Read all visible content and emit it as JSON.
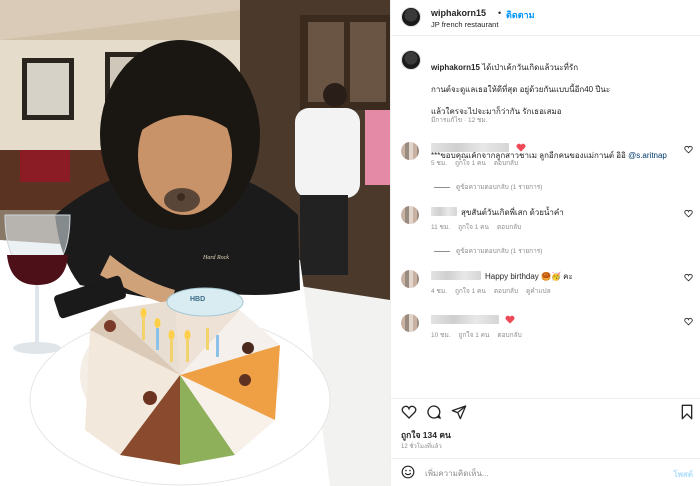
{
  "header": {
    "username": "wiphakorn15",
    "separator": "•",
    "follow_label": "ติดตาม",
    "location": "JP french restaurant"
  },
  "caption": {
    "username": "wiphakorn15",
    "text_line1": "ได้เป่าเค้กวันเกิดแล้วนะที่รัก",
    "text_line2": "กานต์จะดูแลเธอให้ดีที่สุด อยู่ด้วยกันแบบนี้อีก40 ปีนะ",
    "text_line3": "แล้วใครจะไปจะมาก็ว่ากัน รักเธอเสมอ",
    "text_line4": "***ขอบคุณเค้กจากลูกสาวชาเม ลูกอีกคนของแม่กานต์ อิอิ",
    "mention": "@s.aritnap",
    "meta": "มีการแก้ไข · 12 ชม."
  },
  "comments": [
    {
      "text": "",
      "has_heart_emoji": true,
      "time": "5 ชม.",
      "likes": "ถูกใจ 1 คน",
      "reply": "ตอบกลับ",
      "translate": "",
      "replies": "ดูข้อความตอบกลับ (1 รายการ)"
    },
    {
      "text": "สุขสันต์วันเกิดพี่เสก ด้วยน้ำคำ",
      "has_heart_emoji": false,
      "time": "11 ชม.",
      "likes": "ถูกใจ 1 คน",
      "reply": "ตอบกลับ",
      "translate": "",
      "replies": "ดูข้อความตอบกลับ (1 รายการ)"
    },
    {
      "text": "Happy birthday 🥮🥳 คะ",
      "has_heart_emoji": false,
      "time": "4 ชม.",
      "likes": "ถูกใจ 1 คน",
      "reply": "ตอบกลับ",
      "translate": "ดูคำแปล",
      "replies": ""
    },
    {
      "text": "",
      "has_heart_emoji": true,
      "time": "10 ชม.",
      "likes": "ถูกใจ 1 คน",
      "reply": "ตอบกลับ",
      "translate": "",
      "replies": ""
    }
  ],
  "actions": {
    "likes": "ถูกใจ 134 คน",
    "ago": "12 ชั่วโมงที่แล้ว"
  },
  "add_comment": {
    "placeholder": "เพิ่มความคิดเห็น...",
    "post_label": "โพสต์"
  },
  "photo": {
    "cake_sign": "HBD",
    "shirt_text": "Hard Rock"
  },
  "colors": {
    "link_blue": "#0095f6",
    "heart_red": "#ed4956",
    "muted": "#8e8e8e"
  },
  "icons": [
    "heart-icon",
    "comment-icon",
    "share-icon",
    "bookmark-icon",
    "emoji-icon"
  ]
}
